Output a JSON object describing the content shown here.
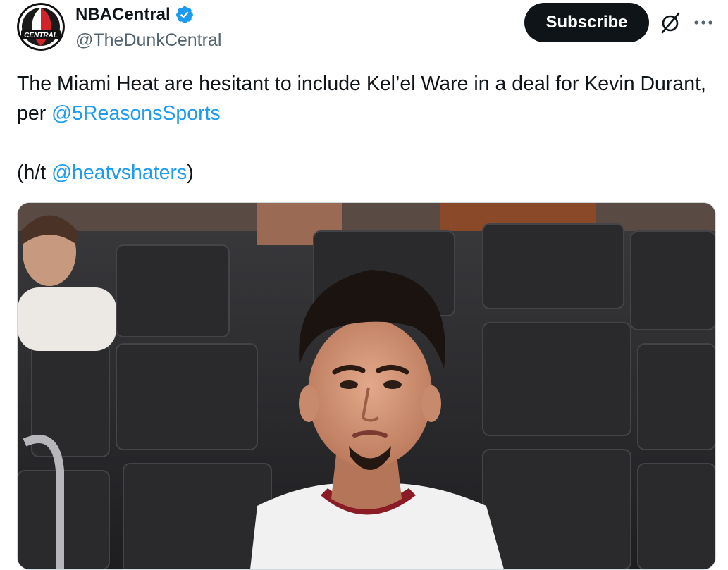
{
  "author": {
    "display_name": "NBACentral",
    "handle": "@TheDunkCentral",
    "verified": true,
    "avatar_icon": "nba-central-logo",
    "avatar_text": "CENTRAL"
  },
  "actions": {
    "subscribe_label": "Subscribe",
    "grok_icon": "grok-icon",
    "more_icon": "more-icon"
  },
  "tweet": {
    "text_part1": "The Miami Heat are hesitant to include Kel’el Ware in a deal for Kevin Durant, per ",
    "mention1": "@5ReasonsSports",
    "text_part2": "(h/t ",
    "mention2": "@heatvshaters",
    "text_part3": ")"
  },
  "media": {
    "type": "photo",
    "subject": "basketball player in white jersey in front of dark arena seats"
  },
  "colors": {
    "accent": "#1d9bf0",
    "text": "#0f1419",
    "secondary": "#536471",
    "button_bg": "#0f1419",
    "verified": "#1d9bf0"
  }
}
